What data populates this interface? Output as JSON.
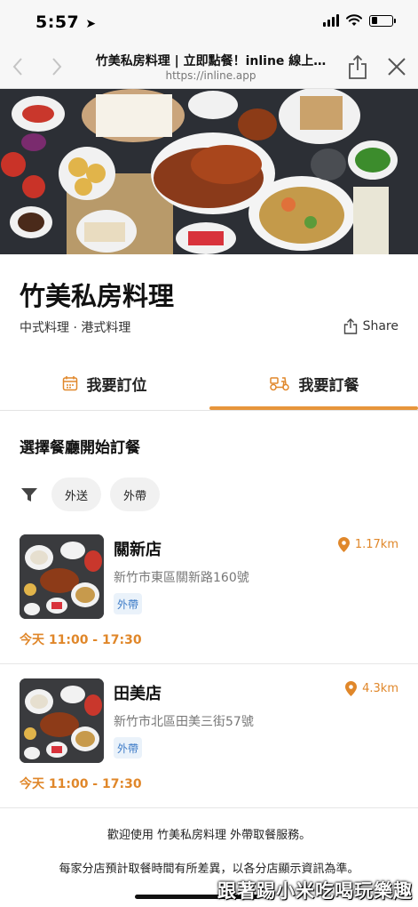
{
  "status_bar": {
    "time": "5:57"
  },
  "browser": {
    "page_title": "竹美私房料理 | 立即點餐！inline 線上…",
    "url": "https://inline.app"
  },
  "restaurant": {
    "name": "竹美私房料理",
    "cuisine": "中式料理 · 港式料理",
    "share_label": "Share"
  },
  "tabs": [
    {
      "label": "我要訂位",
      "icon": "calendar-icon"
    },
    {
      "label": "我要訂餐",
      "icon": "scooter-icon",
      "active": true
    }
  ],
  "section_title": "選擇餐廳開始訂餐",
  "filters": [
    "外送",
    "外帶"
  ],
  "stores": [
    {
      "name": "關新店",
      "address": "新竹市東區關新路160號",
      "badge": "外帶",
      "distance": "1.17km",
      "hours": "今天 11:00 - 17:30"
    },
    {
      "name": "田美店",
      "address": "新竹市北區田美三街57號",
      "badge": "外帶",
      "distance": "4.3km",
      "hours": "今天 11:00 - 17:30"
    }
  ],
  "footer": {
    "line1": "歡迎使用 竹美私房料理 外帶取餐服務。",
    "line2": "每家分店預計取餐時間有所差異，以各分店顯示資訊為準。"
  },
  "watermark": "跟著踢小米吃喝玩樂趣",
  "colors": {
    "accent": "#e7953b",
    "badge_bg": "#eaf2fa",
    "badge_text": "#3d7bc7"
  }
}
